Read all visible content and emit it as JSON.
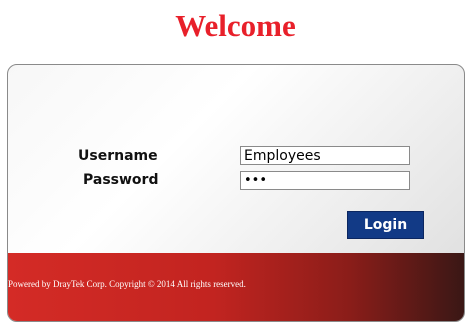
{
  "header": {
    "title": "Welcome"
  },
  "form": {
    "username_label": "Username",
    "password_label": "Password",
    "username_value": "Employees",
    "password_value": "123",
    "login_label": "Login"
  },
  "footer": {
    "copyright": "Powered by DrayTek Corp. Copyright © 2014 All rights reserved."
  },
  "colors": {
    "title": "#e8202a",
    "button": "#123a86",
    "footer_red": "#c22420",
    "footer_dark": "#3a1715"
  }
}
